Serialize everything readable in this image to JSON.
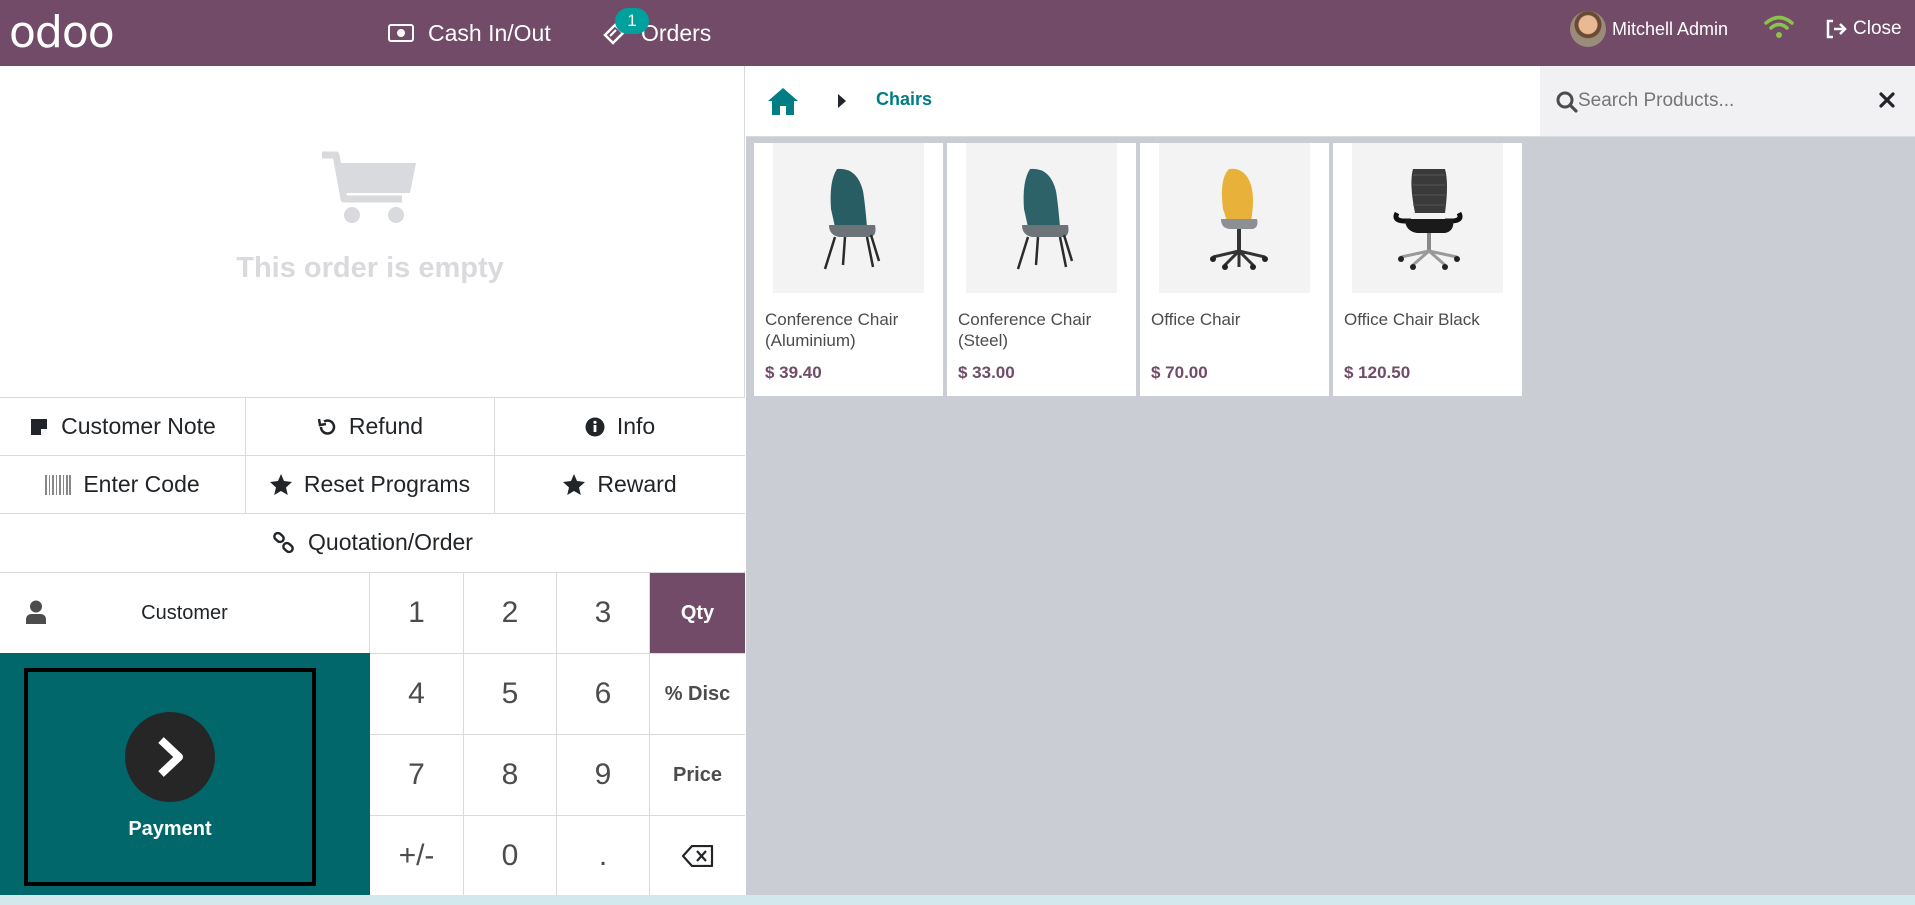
{
  "header": {
    "logo": "odoo",
    "cash_in_out": "Cash In/Out",
    "orders": "Orders",
    "orders_badge": "1",
    "user_name": "Mitchell Admin",
    "close": "Close"
  },
  "order": {
    "empty_message": "This order is empty"
  },
  "controls": {
    "customer_note": "Customer Note",
    "refund": "Refund",
    "info": "Info",
    "enter_code": "Enter Code",
    "reset_programs": "Reset Programs",
    "reward": "Reward",
    "quotation_order": "Quotation/Order"
  },
  "customer": {
    "label": "Customer"
  },
  "payment": {
    "label": "Payment"
  },
  "numpad": {
    "keys": [
      "1",
      "2",
      "3",
      "Qty",
      "4",
      "5",
      "6",
      "% Disc",
      "7",
      "8",
      "9",
      "Price",
      "+/-",
      "0",
      ".",
      "backspace"
    ],
    "active_mode": "Qty"
  },
  "breadcrumb": {
    "category": "Chairs"
  },
  "search": {
    "placeholder": "Search Products..."
  },
  "products": [
    {
      "name": "Conference Chair (Aluminium)",
      "price": "$ 39.40",
      "image": "teal-chair-icon"
    },
    {
      "name": "Conference Chair (Steel)",
      "price": "$ 33.00",
      "image": "teal-chair-icon"
    },
    {
      "name": "Office Chair",
      "price": "$ 70.00",
      "image": "yellow-office-chair-icon"
    },
    {
      "name": "Office Chair Black",
      "price": "$ 120.50",
      "image": "black-office-chair-icon"
    }
  ],
  "colors": {
    "brand": "#714b67",
    "teal": "#01676b",
    "accent": "#017e84",
    "background": "#cbcdd4",
    "wifi": "#8bc34a"
  }
}
